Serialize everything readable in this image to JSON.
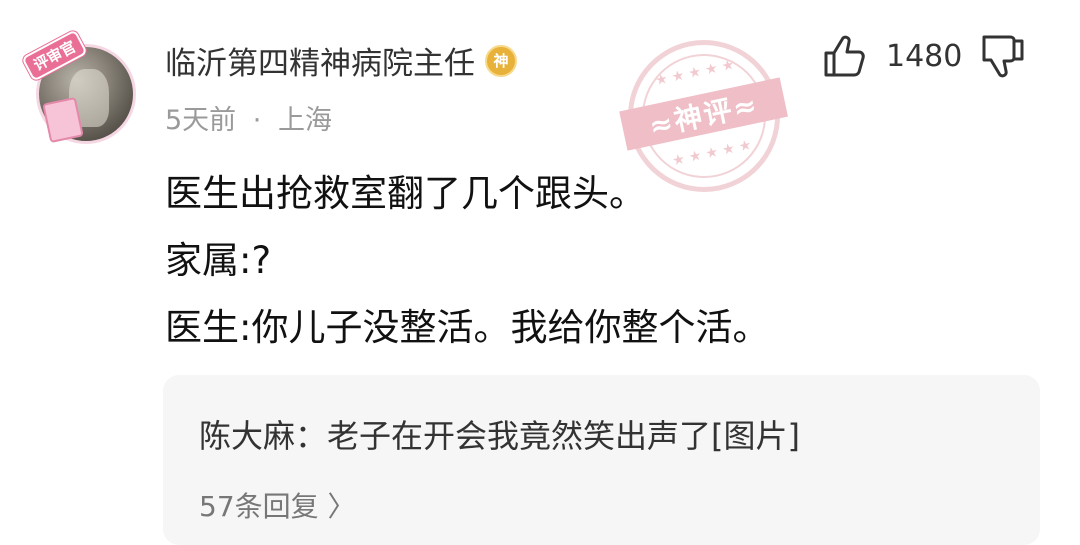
{
  "comment": {
    "avatar_pendant_text": "评审官",
    "username": "临沂第四精神病院主任",
    "badge_text": "神",
    "time": "5天前",
    "separator": "·",
    "location": "上海",
    "seal_text": "≈神评≈",
    "likes": "1480",
    "lines": [
      "医生出抢救室翻了几个跟头。",
      "家属:?",
      "医生:你儿子没整活。我给你整个活。"
    ]
  },
  "replies": {
    "top_reply_author": "陈大麻",
    "top_reply_colon": "：",
    "top_reply_text": "老子在开会我竟然笑出声了[图片]",
    "reply_count_label": "57条回复",
    "chevron": "〉"
  },
  "icons": {
    "like": "thumbs-up-icon",
    "dislike": "thumbs-down-icon",
    "badge": "god-comment-badge-icon",
    "seal": "god-comment-stamp"
  },
  "colors": {
    "badge": "#e8b23a",
    "seal": "#e28a98",
    "meta_text": "#9a9a9a",
    "reply_bg": "#f6f6f7"
  }
}
